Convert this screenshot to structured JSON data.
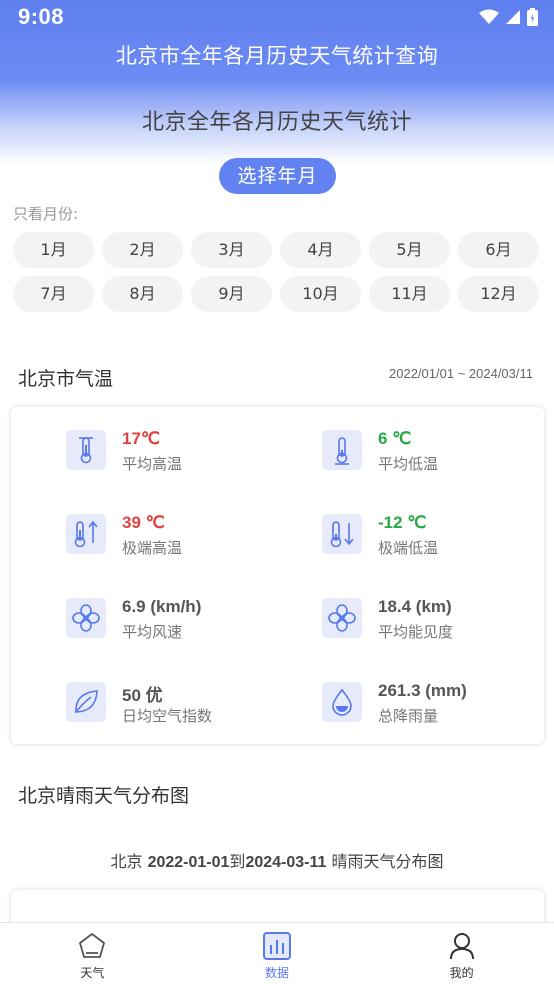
{
  "status_bar": {
    "time": "9:08",
    "icons": [
      "wifi-icon",
      "signal-icon",
      "battery-icon"
    ]
  },
  "header": {
    "app_title": "北京市全年各月历史天气统计查询",
    "page_title": "北京全年各月历史天气统计",
    "pick_button": "选择年月"
  },
  "month_filter": {
    "caption": "只看月份:",
    "months": [
      "1月",
      "2月",
      "3月",
      "4月",
      "5月",
      "6月",
      "7月",
      "8月",
      "9月",
      "10月",
      "11月",
      "12月"
    ]
  },
  "temperature_section": {
    "title": "北京市气温",
    "date_range": "2022/01/01 ~ 2024/03/11"
  },
  "stats": [
    {
      "value": "17℃",
      "label": "平均高温",
      "icon": "thermometer-high-icon",
      "color": "#e0433f"
    },
    {
      "value": "6 ℃",
      "label": "平均低温",
      "icon": "thermometer-low-icon",
      "color": "#2aa748"
    },
    {
      "value": "39 ℃",
      "label": "极端高温",
      "icon": "thermometer-rise-icon",
      "color": "#e0433f"
    },
    {
      "value": "-12 ℃",
      "label": "极端低温",
      "icon": "thermometer-fall-icon",
      "color": "#2aa748"
    },
    {
      "value": "6.9 (km/h)",
      "label": "平均风速",
      "icon": "fan-icon",
      "color": "#555555"
    },
    {
      "value": "18.4 (km)",
      "label": "平均能见度",
      "icon": "fan-icon",
      "color": "#555555"
    },
    {
      "value": "50 优",
      "label": "日均空气指数",
      "icon": "leaf-icon",
      "color": "#555555"
    },
    {
      "value": "261.3 (mm)",
      "label": "总降雨量",
      "icon": "water-drop-icon",
      "color": "#555555"
    }
  ],
  "weather_section": {
    "title": "北京晴雨天气分布图",
    "subtitle_city": "北京 ",
    "subtitle_start": "2022-01-01",
    "subtitle_to": "到",
    "subtitle_end": "2024-03-11",
    "subtitle_suffix": " 晴雨天气分布图"
  },
  "bottom_nav": [
    {
      "label": "天气",
      "icon": "home-weather-icon",
      "active": false
    },
    {
      "label": "数据",
      "icon": "chart-icon",
      "active": true
    },
    {
      "label": "我的",
      "icon": "user-icon",
      "active": false
    }
  ],
  "colors": {
    "accent": "#6282f2",
    "nav_active": "#5878ee",
    "hot": "#e0433f",
    "cold": "#2aa748"
  }
}
